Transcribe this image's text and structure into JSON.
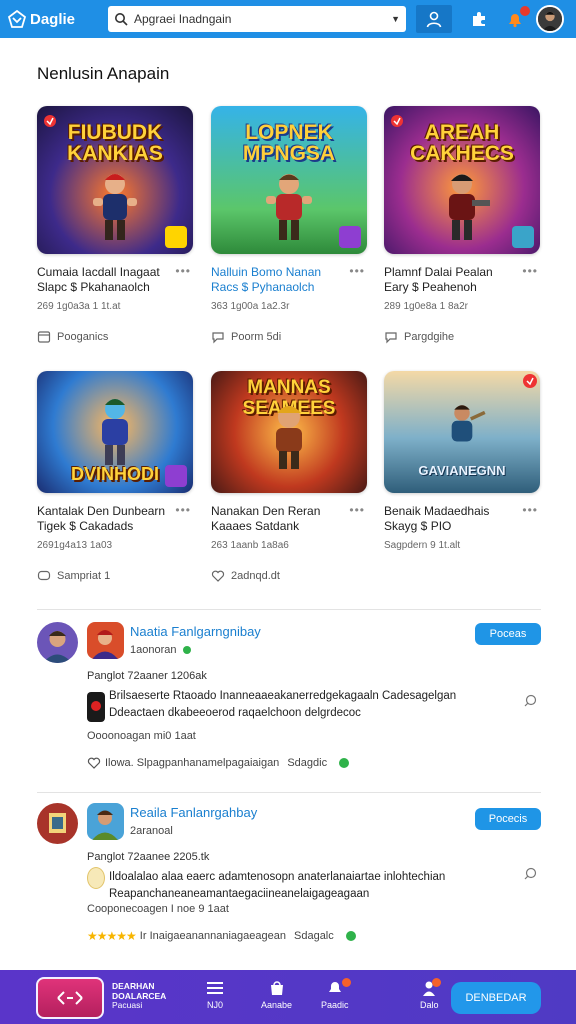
{
  "header": {
    "brand": "Daglie",
    "search_value": "Apgraei Inadngain"
  },
  "section": {
    "title": "Nenlusin Anapain"
  },
  "games": [
    {
      "art_title": "FIUBUDK KANKIAS",
      "title": "Cumaia Iacdall Inagaat Slapc $ Pkahanaolch",
      "meta": "269 1g0a3a 1 1t.at",
      "link": "Pooganics",
      "title_color": "dark"
    },
    {
      "art_title": "LOPNEK MPNGSA",
      "title": "Nalluin Bomo Nanan Racs $ Pyhanaolch",
      "meta": "363 1g00a 1a2.3r",
      "link": "Poorm 5di",
      "title_color": "blue"
    },
    {
      "art_title": "AREAH CAKHECS",
      "title": "Plamnf Dalai Pealan Eary $ Peahenoh",
      "meta": "289 1g0e8a 1 8a2r",
      "link": "Pargdgihe",
      "title_color": "dark"
    },
    {
      "art_title": "DVINHODI",
      "title": "Kantalak Den Dunbearn Tigek $ Cakadads",
      "meta": "2691g4a13 1a03",
      "link": "Sampriat 1",
      "title_color": "dark"
    },
    {
      "art_title": "MANNAS SEAMEES",
      "title": "Nanakan Den Reran Kaaaes Satdank",
      "meta": "263 1aanb 1a8a6",
      "link": "2adnqd.dt",
      "title_color": "dark"
    },
    {
      "art_title": "GAVIANEGNN",
      "title": "Benaik Madaedhais Skayg $ PIO",
      "meta": "Sagpdern 9 1t.alt",
      "link": "",
      "title_color": "dark"
    }
  ],
  "posts": [
    {
      "name": "Naatia Fanlgarngnibay",
      "sub": "1aonoran",
      "date": "Panglot 72aaner 1206ak",
      "body": "Brilsaeserte Rtaoado Inanneaaeakanerredgekagaaln Cadesagelgan Ddeactaen dkabeeoerod raqaelchoon delgrdecoc",
      "stats": "Oooonoagan mi0 1aat",
      "actions": "Ilowa. Slpagpanhanamelpagaiaigan",
      "actions_extra": "Sdagdic",
      "follow_label": "Poceas"
    },
    {
      "name": "Reaila Fanlanrgahbay",
      "sub": "2aranoal",
      "date": "Panglot 72aanee 2205.tk",
      "body": "Ildoalalao alaa eaerc adamtenosopn anaterlanaiartae inlohtechian Reapanchaneaneamantaegaciineanelaigageagaan",
      "stats": "Cooponecoagen I noe 9 1aat",
      "actions": "Ir Inaigaeanannaniagaeagean",
      "actions_extra": "Sdagalc",
      "stars": "★★★★★",
      "follow_label": "Pocecis"
    }
  ],
  "bottom": {
    "promo_line1": "DEARHAN",
    "promo_line2": "DOALARCEA",
    "promo_line3": "Pacuasi",
    "nav": [
      {
        "label": "NJ0"
      },
      {
        "label": "Aanabe"
      },
      {
        "label": "Paadic"
      },
      {
        "label": "Dalo"
      }
    ],
    "cta": "DENBEDAR"
  }
}
